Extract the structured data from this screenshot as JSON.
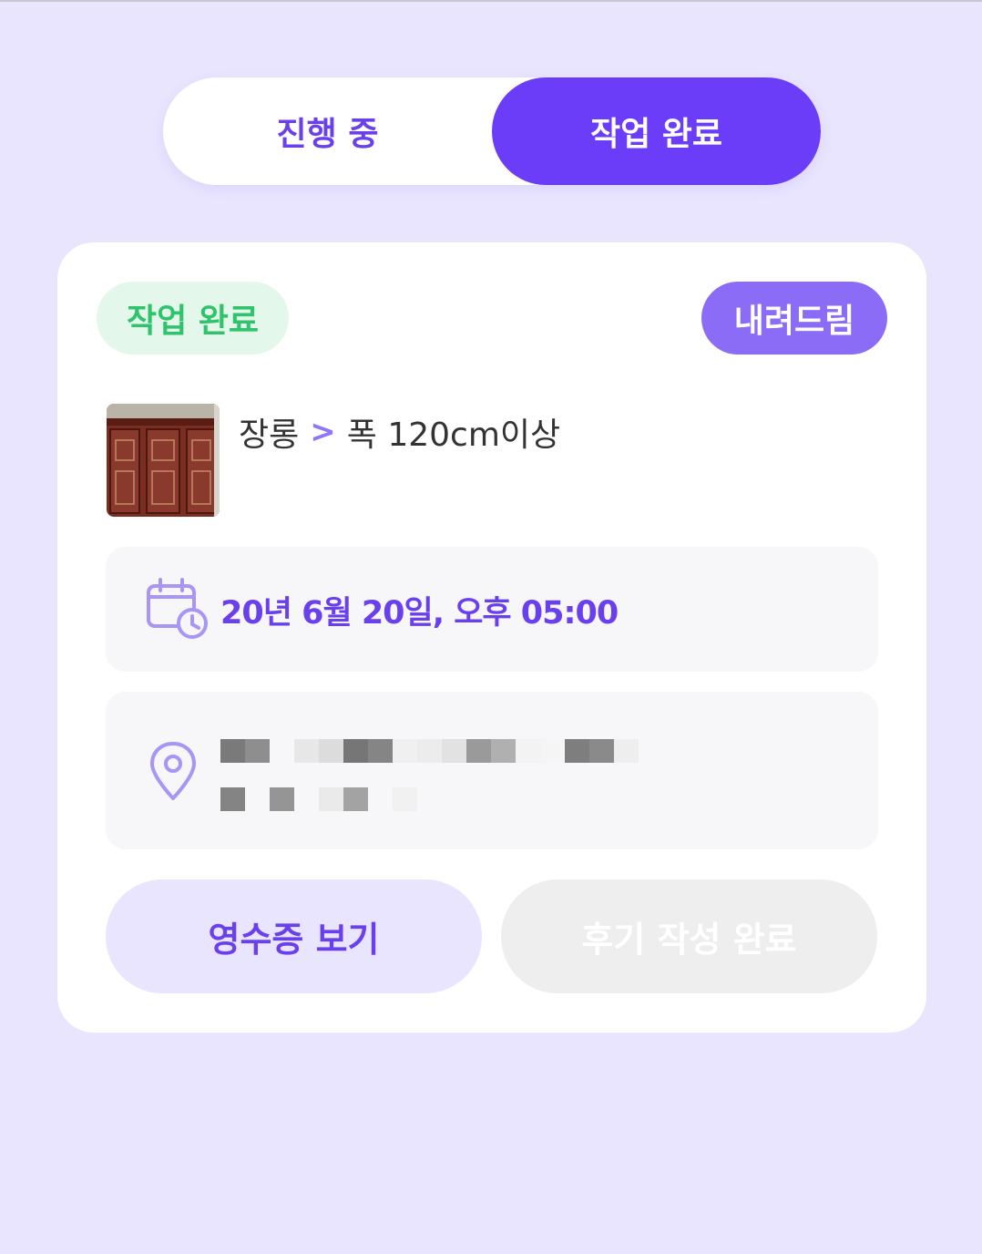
{
  "tabs": [
    {
      "label": "진행 중",
      "selected": false
    },
    {
      "label": "작업 완료",
      "selected": true
    }
  ],
  "card": {
    "status_badge": "작업 완료",
    "service_badge": "내려드림",
    "item": {
      "category": "장롱",
      "separator_icon": "chevron-right-icon",
      "spec": "폭 120cm이상"
    },
    "datetime": "20년 6월 20일, 오후 05:00",
    "buttons": {
      "receipt": "영수증 보기",
      "review": "후기 작성 완료"
    }
  },
  "icons": {
    "calendar": "calendar-clock-icon",
    "location": "location-pin-icon"
  },
  "colors": {
    "background": "#e9e5ff",
    "accent": "#6b3df9",
    "service_badge": "#8b6cf6",
    "success": "#2fc46b",
    "disabled": "#eeeeee"
  }
}
